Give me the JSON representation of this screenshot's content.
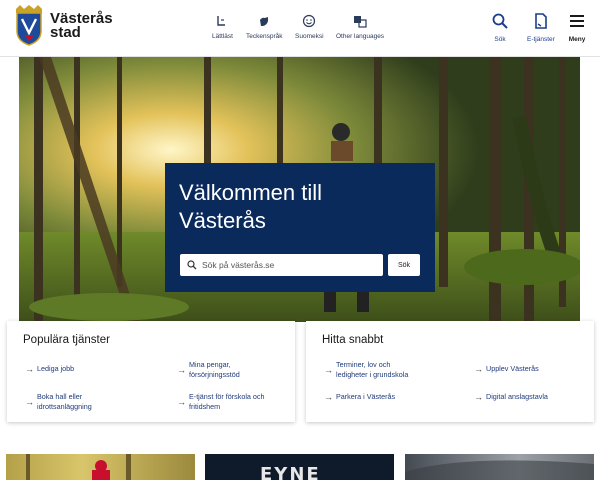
{
  "header": {
    "logo": {
      "line1": "Västerås",
      "line2": "stad",
      "icon": "city-crest-icon"
    },
    "tools": [
      {
        "label": "Lättläst",
        "icon": "easy-read-icon"
      },
      {
        "label": "Teckenspråk",
        "icon": "sign-language-icon"
      },
      {
        "label": "Suomeksi",
        "icon": "finnish-icon"
      },
      {
        "label": "Other languages",
        "icon": "translate-icon"
      }
    ],
    "actions": {
      "search": {
        "label": "Sök",
        "icon": "search-icon"
      },
      "eservices": {
        "label": "E-tjänster",
        "icon": "document-icon"
      },
      "menu": {
        "label": "Meny",
        "icon": "hamburger-icon"
      }
    }
  },
  "hero": {
    "title_line1": "Välkommen till",
    "title_line2": "Västerås",
    "search": {
      "placeholder": "Sök på västerås.se",
      "button": "Sök"
    }
  },
  "popular": {
    "title": "Populära tjänster",
    "links": [
      {
        "text1": "Lediga jobb",
        "text2": ""
      },
      {
        "text1": "Mina pengar,",
        "text2": "försörjningsstöd"
      },
      {
        "text1": "Boka hall eller",
        "text2": "idrottsanläggning"
      },
      {
        "text1": "E-tjänst för förskola och",
        "text2": "fritidshem"
      }
    ]
  },
  "quick": {
    "title": "Hitta snabbt",
    "links": [
      {
        "text1": "Terminer, lov och",
        "text2": "ledigheter i grundskola"
      },
      {
        "text1": "Upplev Västerås",
        "text2": ""
      },
      {
        "text1": "Parkera i Västerås",
        "text2": ""
      },
      {
        "text1": "Digital anslagstavla",
        "text2": ""
      }
    ]
  },
  "teasers": [
    {
      "text": ""
    },
    {
      "text": "EYNE"
    },
    {
      "text": ""
    }
  ],
  "colors": {
    "navy": "#0b2a5c",
    "link": "#203a7a",
    "brand_red": "#c8102e"
  }
}
